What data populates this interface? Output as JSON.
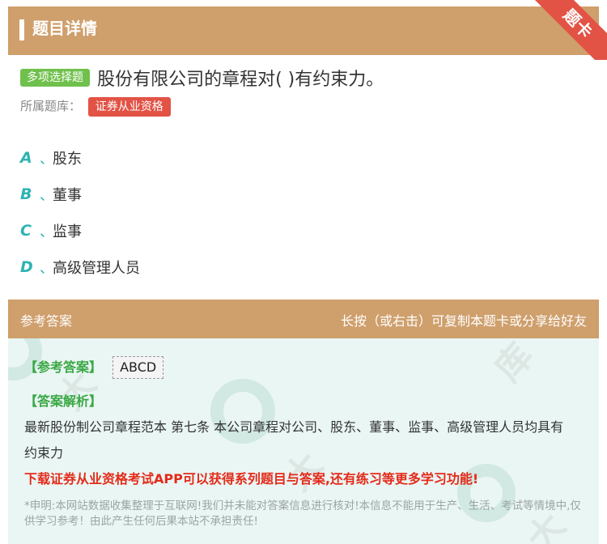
{
  "header": {
    "title": "题目详情",
    "ribbon": "题卡"
  },
  "question": {
    "type_tag": "多项选择题",
    "text": "股份有限公司的章程对( )有约束力。",
    "library_label": "所属题库：",
    "library_tag": "证券从业资格"
  },
  "options": [
    {
      "letter": "A",
      "sep": "、",
      "text": "股东"
    },
    {
      "letter": "B",
      "sep": "、",
      "text": "董事"
    },
    {
      "letter": "C",
      "sep": "、",
      "text": "监事"
    },
    {
      "letter": "D",
      "sep": "、",
      "text": "高级管理人员"
    }
  ],
  "answer_section": {
    "title": "参考答案",
    "hint": "长按（或右击）可复制本题卡或分享给好友",
    "answer_label": "【参考答案】",
    "answer_value": "ABCD",
    "analysis_label": "【答案解析】",
    "analysis_text": "最新股份制公司章程范本   第七条 本公司章程对公司、股东、董事、监事、高级管理人员均具有约束力",
    "promo": "下载证券从业资格考试APP可以获得系列题目与答案,还有练习等更多学习功能!",
    "disclaimer": "*申明:本网站数据收集整理于互联网!我们并未能对答案信息进行核对!本信息不能用于生产、生活、考试等情境中,仅供学习参考！由此产生任何后果本站不承担责任!"
  },
  "colors": {
    "header_bg": "#cf9f6c",
    "type_tag_bg": "#70c04d",
    "library_tag_bg": "#e25345",
    "option_letter": "#2fb3b3",
    "answer_bg": "#eaf6f4",
    "promo_text": "#e42b1a"
  }
}
